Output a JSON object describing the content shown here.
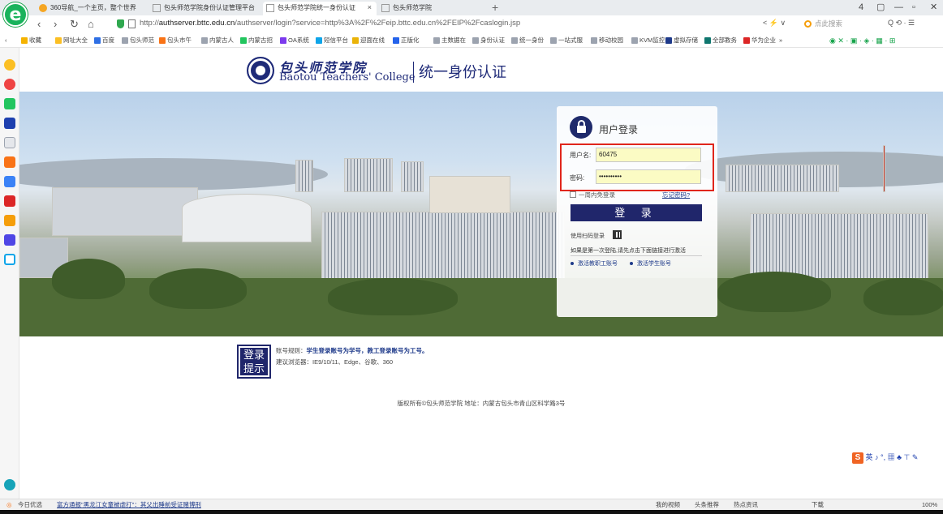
{
  "browser": {
    "logo_letter": "e",
    "tabs": [
      {
        "label": "360导航_一个主页，整个世界",
        "active": false
      },
      {
        "label": "包头师范学院身份认证管理平台",
        "active": false
      },
      {
        "label": "包头师范学院统一身份认证",
        "active": true
      },
      {
        "label": "包头师范学院",
        "active": false
      }
    ],
    "tab_add": "+",
    "window_controls": [
      "4",
      "▢",
      "—",
      "▫",
      "✕"
    ],
    "nav": {
      "back": "‹",
      "forward": "›",
      "refresh": "↻",
      "home": "⌂"
    },
    "url_prefix": "http://",
    "url_host": "authserver.bttc.edu.cn",
    "url_path": "/authserver/login?service=http%3A%2F%2Feip.bttc.edu.cn%2FEIP%2Fcaslogin.jsp",
    "addr_right": "< ⚡ ∨",
    "search_placeholder": "点此搜索",
    "menu_icons": "Q  ⟲ ·  ☰",
    "bookmarks": [
      "收藏",
      "网址大全",
      "百度",
      "包头师范",
      "包头市午",
      "内蒙古人",
      "内蒙古招",
      "OA系统",
      "短信平台",
      "迎面在线",
      "正版化",
      "主数据在",
      "身份认证",
      "统一身份",
      "一站式服",
      "移动校园",
      "KVM监控",
      "虚拟存储",
      "全部教务",
      "华为企业",
      "»"
    ],
    "bookmarks_right": "◉  ✕ ·  ▣ ·  ◈ ·  ▦ ·  ⊞"
  },
  "header": {
    "school_cn": "包头师范学院",
    "school_en": "Baotou Teachers' College",
    "title": "统一身份认证"
  },
  "login": {
    "title": "用户登录",
    "username_label": "用户名:",
    "username_value": "60475",
    "password_label": "密码:",
    "password_value": "••••••••••",
    "remember_label": "一周内免登录",
    "forgot_label": "忘记密码?",
    "login_button": "登 录",
    "qr_label": "使用扫码登录",
    "activate_tip": "如果是第一次登陆,请先点击下面链接进行激活",
    "activate_staff": "激活教职工账号",
    "activate_student": "激活学生账号"
  },
  "tips": {
    "badge_line1": "登录",
    "badge_line2": "提示",
    "rule_prefix": "账号规则：",
    "rule_text": "学生登录账号为学号，教工登录账号为工号。",
    "browser_tip": "建议浏览器：IE9/10/11、Edge、谷歌、360"
  },
  "footer": {
    "copyright": "版权所有©包头师范学院 地址：内蒙古包头市青山区科学路3号"
  },
  "ime": {
    "logo": "S",
    "text": "英 ♪ °, ▦ ♣ ⊤ ✎"
  },
  "statusbar": {
    "today": "今日优选",
    "news": "富方通报\"黑龙江女童被虐打\"：其父出睡前受证赌博刑",
    "items": [
      "我的视频",
      "头条推荐",
      "热点资讯",
      "下载",
      "100%"
    ]
  },
  "colors": {
    "brand_navy": "#20266b",
    "highlight_red": "#e0261c",
    "input_yellow": "#fbfbc4"
  }
}
